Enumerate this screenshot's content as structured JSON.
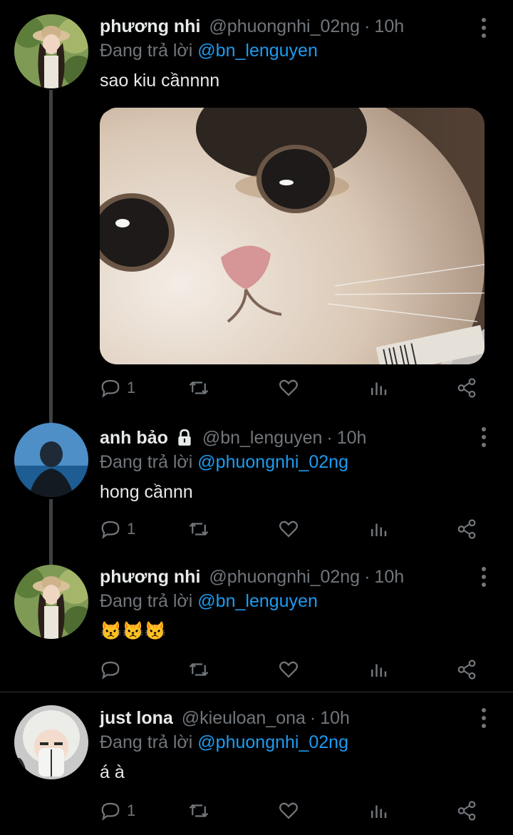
{
  "tweets": [
    {
      "name": "phương nhi",
      "handle": "@phuongnhi_02ng",
      "time": "10h",
      "reply_prefix": "Đang trả lời",
      "reply_to": "@bn_lenguyen",
      "text": "sao kiu cầnnnn",
      "reply_count": "1"
    },
    {
      "name": "anh bảo",
      "handle": "@bn_lenguyen",
      "time": "10h",
      "reply_prefix": "Đang trả lời",
      "reply_to": "@phuongnhi_02ng",
      "text": "hong cầnnn",
      "reply_count": "1"
    },
    {
      "name": "phương nhi",
      "handle": "@phuongnhi_02ng",
      "time": "10h",
      "reply_prefix": "Đang trả lời",
      "reply_to": "@bn_lenguyen",
      "text": "😾😾😾",
      "reply_count": ""
    },
    {
      "name": "just lona",
      "handle": "@kieuloan_ona",
      "time": "10h",
      "reply_prefix": "Đang trả lời",
      "reply_to": "@phuongnhi_02ng",
      "text": "á à",
      "reply_count": "1"
    }
  ],
  "separator": "·",
  "colors": {
    "background": "#000000",
    "text": "#e7e9ea",
    "muted": "#71767b",
    "mention": "#1d9bf0",
    "thread_line": "#3e4144"
  },
  "icons": [
    "reply-icon",
    "retweet-icon",
    "like-icon",
    "views-icon",
    "share-icon",
    "more-icon",
    "lock-icon"
  ]
}
